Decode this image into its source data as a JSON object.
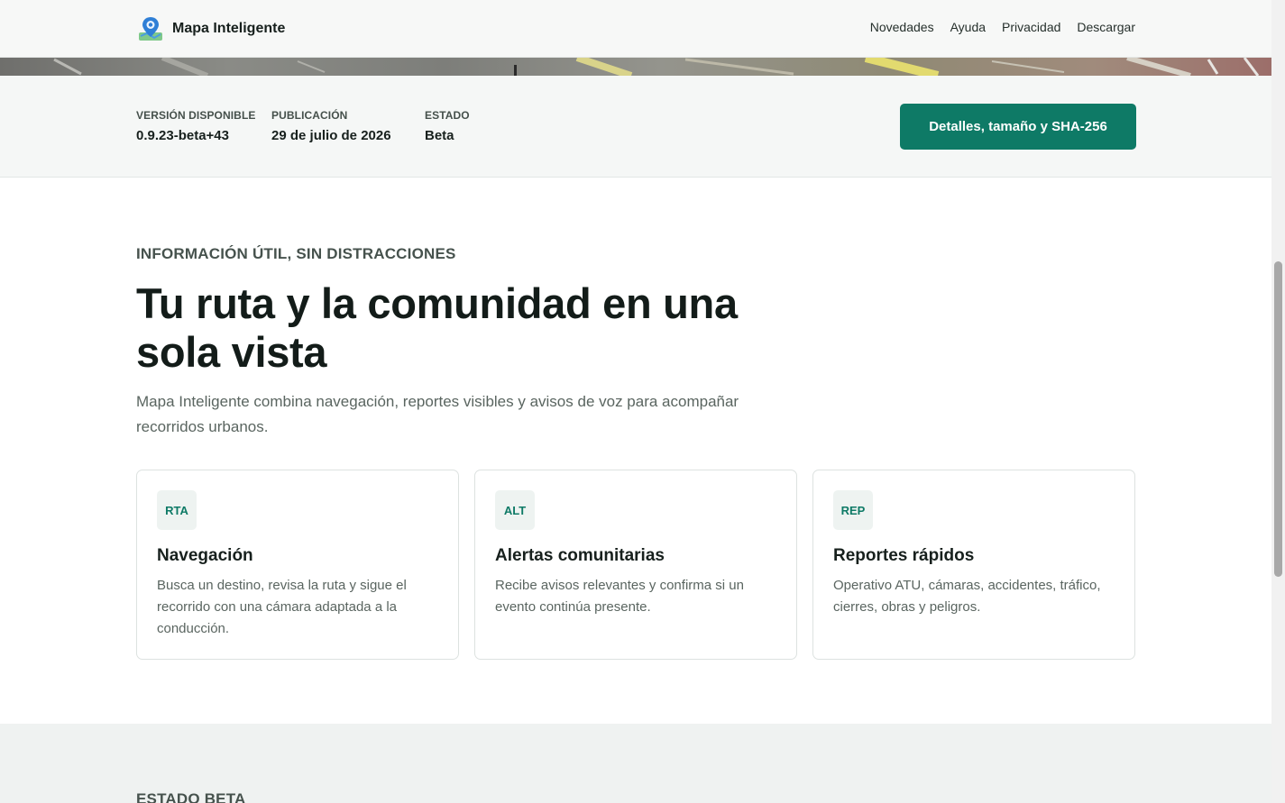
{
  "header": {
    "brand": "Mapa Inteligente",
    "nav": [
      "Novedades",
      "Ayuda",
      "Privacidad",
      "Descargar"
    ]
  },
  "release": {
    "version_label": "VERSIÓN DISPONIBLE",
    "version_value": "0.9.23-beta+43",
    "date_label": "PUBLICACIÓN",
    "date_value": "29 de julio de 2026",
    "status_label": "ESTADO",
    "status_value": "Beta",
    "details_button": "Detalles, tamaño y SHA-256"
  },
  "hero": {
    "eyebrow": "INFORMACIÓN ÚTIL, SIN DISTRACCIONES",
    "title": "Tu ruta y la comunidad en una sola vista",
    "lead": "Mapa Inteligente combina navegación, reportes visibles y avisos de voz para acompañar recorridos urbanos."
  },
  "features": [
    {
      "tag": "RTA",
      "title": "Navegación",
      "text": "Busca un destino, revisa la ruta y sigue el recorrido con una cámara adaptada a la conducción."
    },
    {
      "tag": "ALT",
      "title": "Alertas comunitarias",
      "text": "Recibe avisos relevantes y confirma si un evento continúa presente."
    },
    {
      "tag": "REP",
      "title": "Reportes rápidos",
      "text": "Operativo ATU, cámaras, accidentes, tráfico, cierres, obras y peligros."
    }
  ],
  "beta_section": {
    "title": "ESTADO BETA"
  },
  "colors": {
    "accent": "#0e7a66",
    "heading": "#131c19",
    "muted": "#5a6560"
  },
  "icons": {
    "logo": "map-pin-logo-icon"
  }
}
